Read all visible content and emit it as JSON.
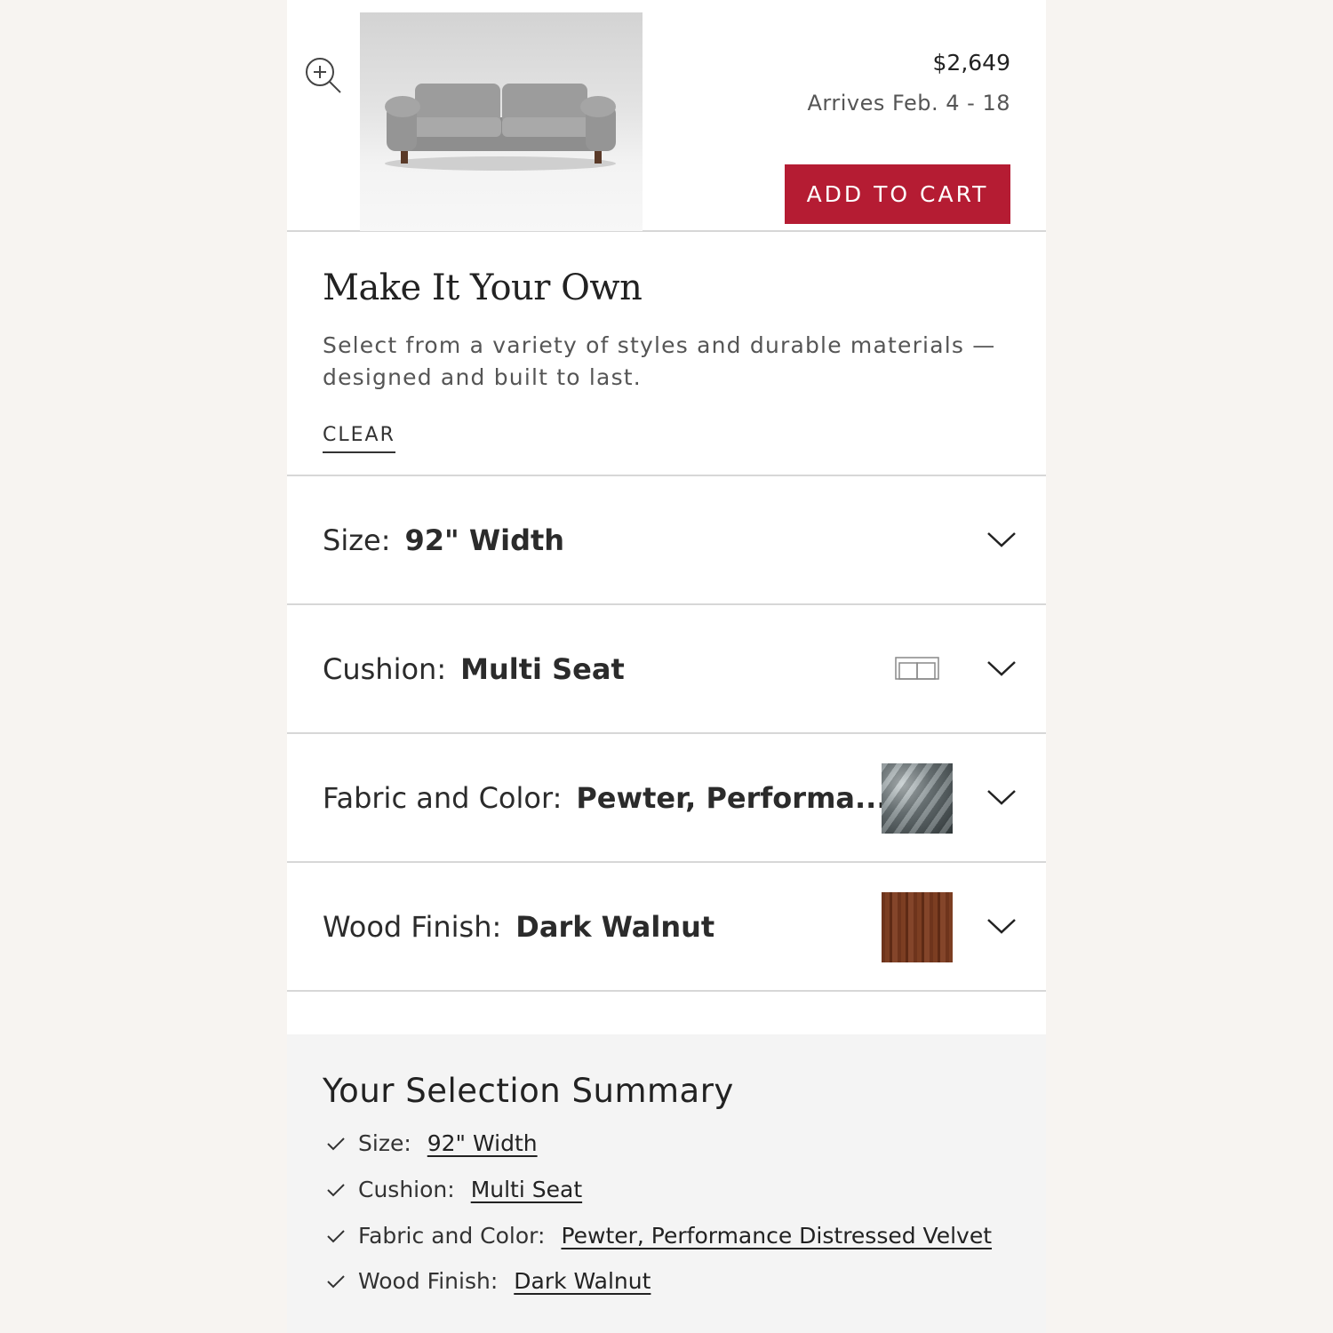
{
  "product": {
    "price": "$2,649",
    "arrives": "Arrives Feb. 4 - 18",
    "add_to_cart": "ADD TO CART"
  },
  "intro": {
    "title": "Make It Your Own",
    "description": "Select from a variety of styles and durable materials — designed and built to last.",
    "clear": "CLEAR"
  },
  "options": [
    {
      "label": "Size:",
      "value": "92\" Width"
    },
    {
      "label": "Cushion:",
      "value": "Multi Seat"
    },
    {
      "label": "Fabric and Color:",
      "value": "Pewter, Performa..."
    },
    {
      "label": "Wood Finish:",
      "value": "Dark Walnut"
    }
  ],
  "summary": {
    "title": "Your Selection Summary",
    "items": [
      {
        "label": "Size:",
        "value": "92\" Width"
      },
      {
        "label": "Cushion:",
        "value": "Multi Seat"
      },
      {
        "label": "Fabric and Color:",
        "value": "Pewter, Performance Distressed Velvet"
      },
      {
        "label": "Wood Finish:",
        "value": "Dark Walnut"
      }
    ]
  },
  "colors": {
    "accent": "#b51c33",
    "background": "#f7f4f1",
    "summary_bg": "#f4f4f4"
  },
  "icons": [
    "zoom-in-icon",
    "chevron-down-icon",
    "check-icon",
    "cushion-layout-icon"
  ]
}
